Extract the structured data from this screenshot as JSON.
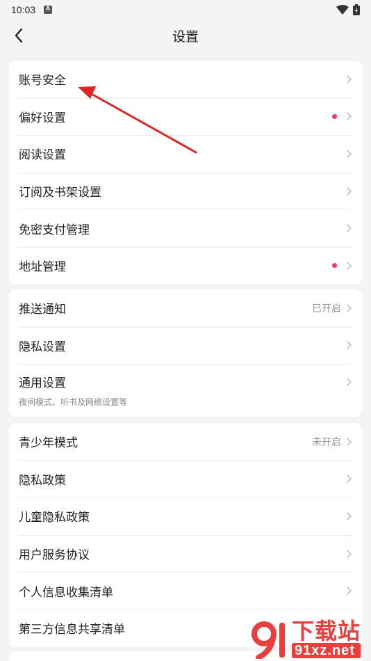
{
  "status_bar": {
    "time": "10:03"
  },
  "header": {
    "title": "设置"
  },
  "group1": {
    "items": [
      {
        "label": "账号安全"
      },
      {
        "label": "偏好设置"
      },
      {
        "label": "阅读设置"
      },
      {
        "label": "订阅及书架设置"
      },
      {
        "label": "免密支付管理"
      },
      {
        "label": "地址管理"
      }
    ]
  },
  "group2": {
    "items": [
      {
        "label": "推送通知",
        "status": "已开启"
      },
      {
        "label": "隐私设置"
      },
      {
        "label": "通用设置",
        "sub": "夜间模式、听书及网络设置等"
      }
    ]
  },
  "group3": {
    "items": [
      {
        "label": "青少年模式",
        "status": "未开启"
      },
      {
        "label": "隐私政策"
      },
      {
        "label": "儿童隐私政策"
      },
      {
        "label": "用户服务协议"
      },
      {
        "label": "个人信息收集清单"
      },
      {
        "label": "第三方信息共享清单"
      }
    ]
  },
  "watermark": {
    "logo_text": "下载站",
    "domain": "91xz.net"
  },
  "colors": {
    "dot": "#ee3b5b",
    "arrow": "#e02424",
    "watermark": "#e8403f"
  }
}
